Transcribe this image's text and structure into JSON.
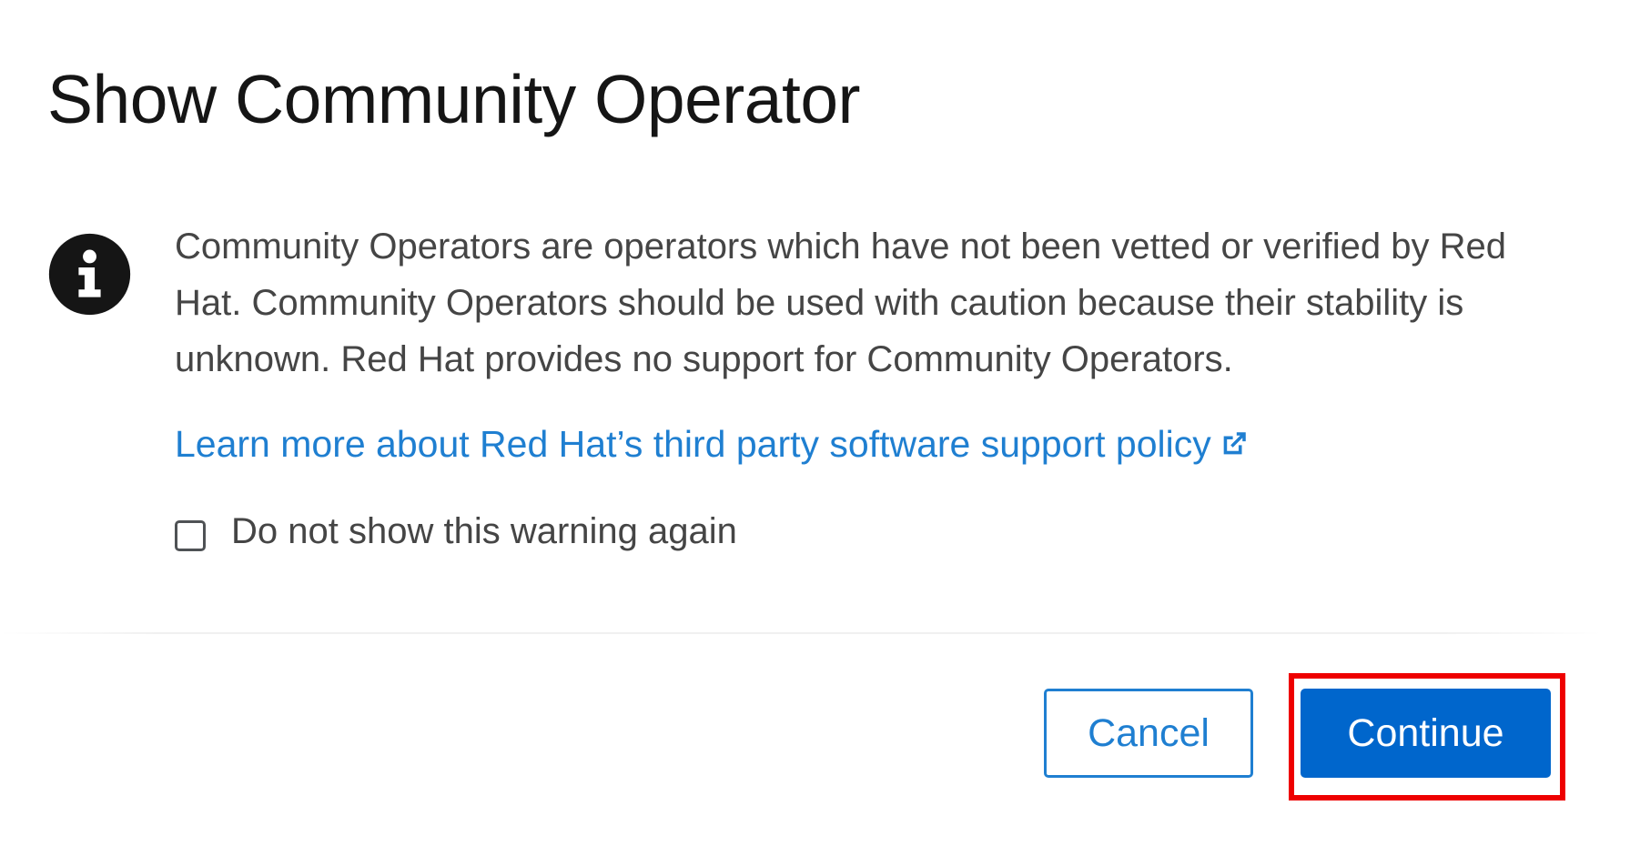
{
  "dialog": {
    "title": "Show Community Operator",
    "icon": "info-circle-icon",
    "body_text": "Community Operators are operators which have not been vetted or verified by Red Hat. Community Operators should be used with caution because their stability is unknown. Red Hat provides no support for Community Operators.",
    "link_text": "Learn more about Red Hat’s third party software support policy",
    "link_icon": "external-link-icon",
    "checkbox": {
      "label": "Do not show this warning again",
      "checked": false
    }
  },
  "footer": {
    "cancel_label": "Cancel",
    "continue_label": "Continue"
  },
  "colors": {
    "primary": "#0066cc",
    "link": "#1f7fd1",
    "highlight": "#ee0000",
    "title": "#151515",
    "body": "#454545"
  }
}
